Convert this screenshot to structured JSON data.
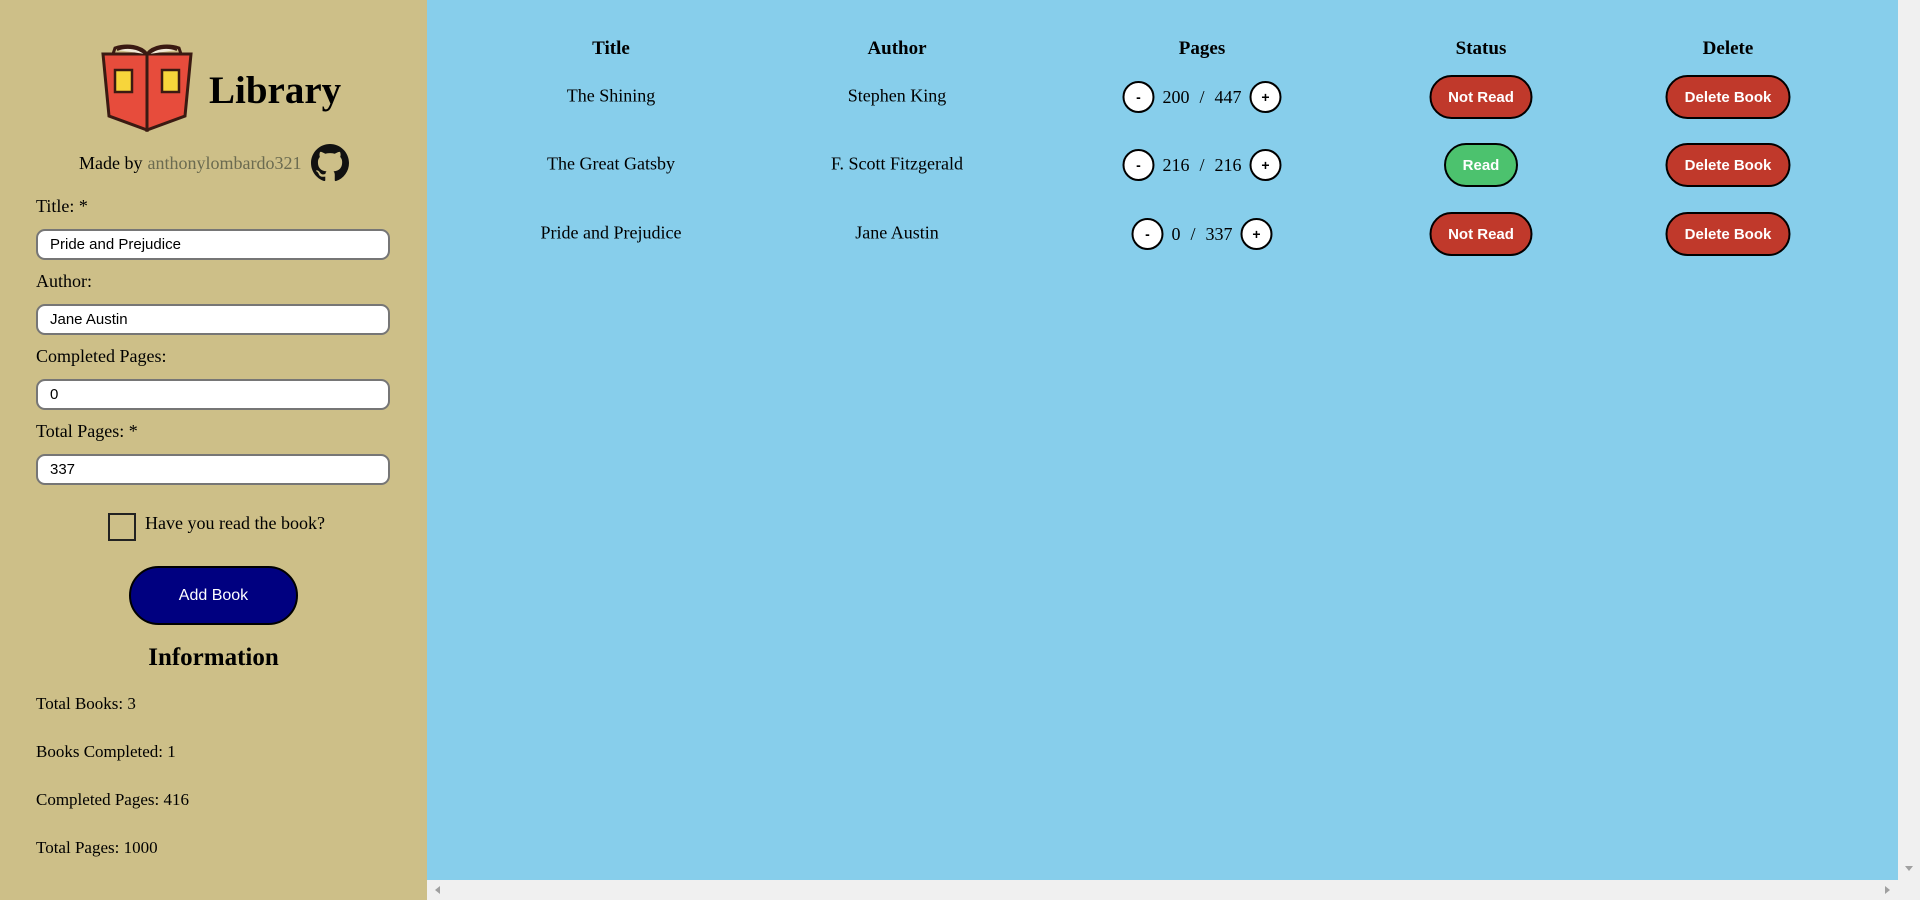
{
  "app": {
    "title": "Library",
    "made_by_prefix": "Made by",
    "author_link": "anthonylombardo321"
  },
  "form": {
    "title_label": "Title: *",
    "title_value": "Pride and Prejudice",
    "author_label": "Author:",
    "author_value": "Jane Austin",
    "completed_label": "Completed Pages:",
    "completed_value": "0",
    "total_label": "Total Pages: *",
    "total_value": "337",
    "read_label": "Have you read the book?",
    "read_checked": false,
    "add_button": "Add Book"
  },
  "info": {
    "title": "Information",
    "total_books": "Total Books: 3",
    "books_completed": "Books Completed: 1",
    "completed_pages": "Completed Pages: 416",
    "total_pages": "Total Pages: 1000"
  },
  "table": {
    "headers": {
      "title": "Title",
      "author": "Author",
      "pages": "Pages",
      "status": "Status",
      "delete": "Delete"
    },
    "rows": [
      {
        "title": "The Shining",
        "author": "Stephen King",
        "completed": "200",
        "sep": "/",
        "total": "447",
        "status": "Not Read",
        "delete": "Delete Book",
        "minus": "-",
        "plus": "+"
      },
      {
        "title": "The Great Gatsby",
        "author": "F. Scott Fitzgerald",
        "completed": "216",
        "sep": "/",
        "total": "216",
        "status": "Read",
        "delete": "Delete Book",
        "minus": "-",
        "plus": "+"
      },
      {
        "title": "Pride and Prejudice",
        "author": "Jane Austin",
        "completed": "0",
        "sep": "/",
        "total": "337",
        "status": "Not Read",
        "delete": "Delete Book",
        "minus": "-",
        "plus": "+"
      }
    ]
  },
  "colors": {
    "sidebar_bg": "#cdbf88",
    "main_bg": "#87ceeb",
    "add_button": "#000080",
    "not_read": "#c0392b",
    "read": "#4cc26e",
    "delete": "#c0392b"
  },
  "icons": {
    "logo": "open-book-icon",
    "github": "github-icon"
  }
}
